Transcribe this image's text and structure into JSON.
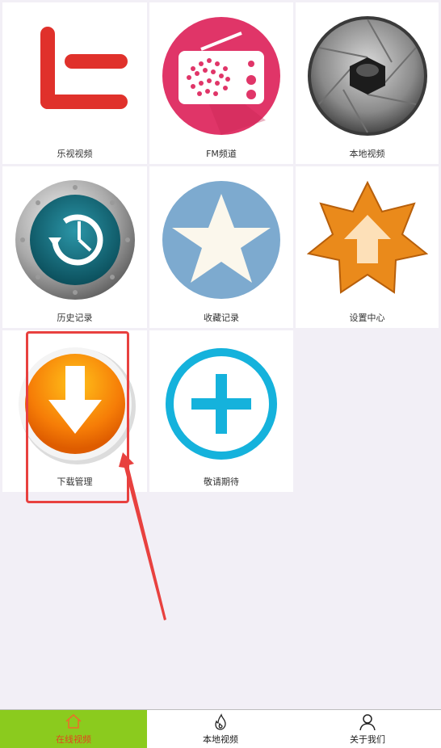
{
  "tiles": [
    {
      "label": "乐视视频",
      "icon": "letv-logo-icon"
    },
    {
      "label": "FM频道",
      "icon": "radio-icon"
    },
    {
      "label": "本地视频",
      "icon": "camera-shutter-icon"
    },
    {
      "label": "历史记录",
      "icon": "time-machine-icon"
    },
    {
      "label": "收藏记录",
      "icon": "star-icon"
    },
    {
      "label": "设置中心",
      "icon": "update-badge-icon"
    },
    {
      "label": "下载管理",
      "icon": "download-icon"
    },
    {
      "label": "敬请期待",
      "icon": "plus-circle-icon"
    }
  ],
  "nav": {
    "items": [
      {
        "label": "在线视频",
        "icon": "home-icon",
        "active": true
      },
      {
        "label": "本地视频",
        "icon": "flame-icon",
        "active": false
      },
      {
        "label": "关于我们",
        "icon": "user-icon",
        "active": false
      }
    ]
  },
  "colors": {
    "nav_active_bg": "#8bcb1e",
    "nav_active_text": "#e2461e",
    "annotation": "#e8413f"
  }
}
